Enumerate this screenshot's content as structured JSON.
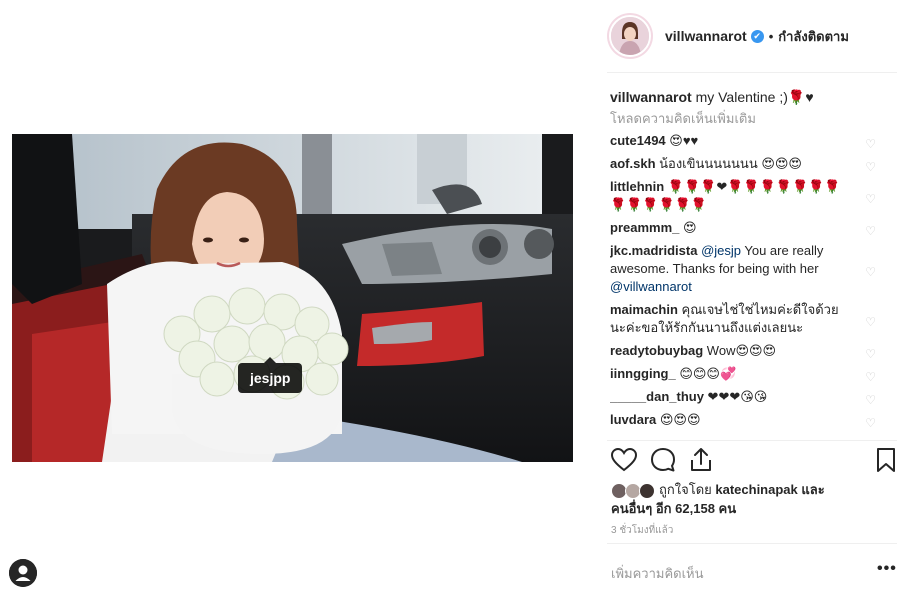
{
  "photo": {
    "tag": "jesjpp"
  },
  "post": {
    "username": "villwannarot",
    "verified_glyph": "✔",
    "dot": "•",
    "follow_status": "กำลังติดตาม",
    "caption_user": "villwannarot",
    "caption_text": " my Valentine ;)🌹♥",
    "load_more": "โหลดความคิดเห็นเพิ่มเติม"
  },
  "comments": [
    {
      "user": "cute1494",
      "text": " 😍♥♥"
    },
    {
      "user": "aof.skh",
      "text": " น้องเขินนนนนนน 😍😍😍"
    },
    {
      "user": "littlehnin",
      "text": " 🌹🌹🌹❤🌹🌹🌹🌹🌹🌹🌹🌹🌹🌹🌹🌹🌹"
    },
    {
      "user": "preammm_",
      "text": " 😍"
    },
    {
      "user": "jkc.madridista",
      "text_before": " ",
      "mention1": "@jesjp",
      "text_middle": " You are really awesome. Thanks for being with her ",
      "mention2": "@villwannarot"
    },
    {
      "user": "maimachin",
      "text": " คุณเจษไช่ใช่ไหมค่ะดีใจด้วยนะค่ะขอให้รักกันนานถึงแต่งเลยนะ"
    },
    {
      "user": "readytobuybag",
      "text": " Wow😍😍😍"
    },
    {
      "user": "iinngging_",
      "text": " 😊😊😊💞"
    },
    {
      "user": "_____dan_thuy",
      "text": " ❤❤❤😘😘"
    },
    {
      "user": "luvdara",
      "text": " 😍😍😍"
    }
  ],
  "likes": {
    "prefix": "ถูกใจโดย ",
    "user": "katechinapak",
    "middle": " และ",
    "line2_start": "คนอื่นๆ อีก ",
    "count": "62,158",
    "unit": " คน"
  },
  "time": "3 ชั่วโมงที่แล้ว",
  "add_comment_placeholder": "เพิ่มความคิดเห็น",
  "more_options": "•••",
  "icons": {
    "like": "heart-outline-icon",
    "comment": "speech-bubble-icon",
    "share": "share-upload-icon",
    "save": "bookmark-icon",
    "comment_like": "small-heart-icon",
    "profile": "profile-avatar-icon"
  },
  "colors": {
    "verified": "#3897f0",
    "meta_text": "#999999",
    "mention": "#003569",
    "divider": "#efefef"
  }
}
